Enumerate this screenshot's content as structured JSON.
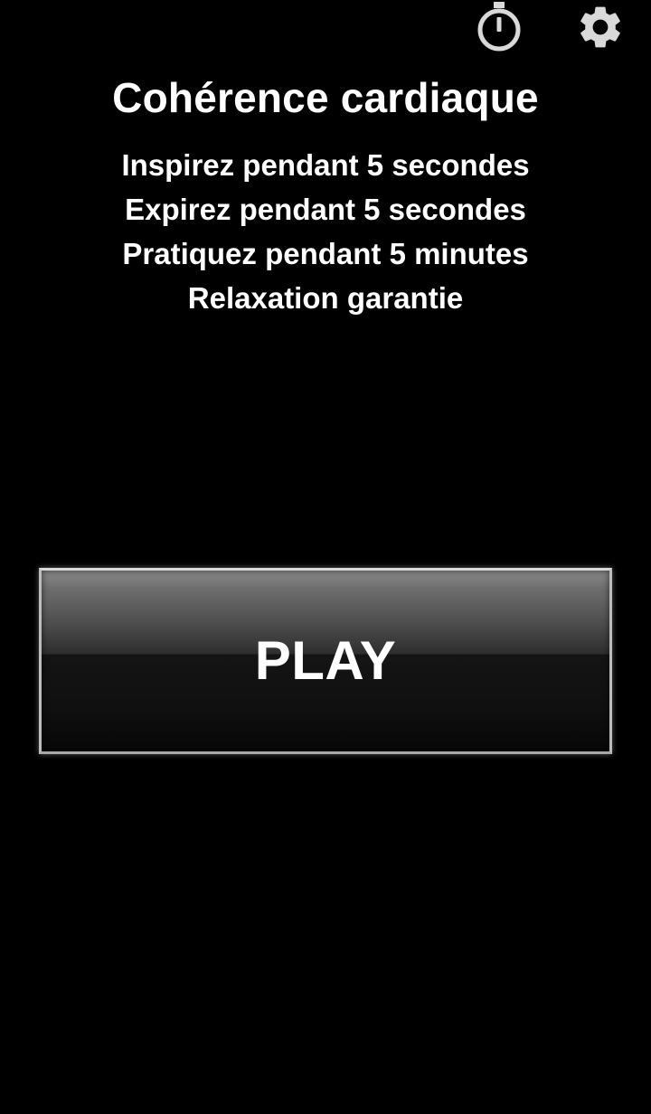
{
  "app": {
    "title": "Cohérence cardiaque"
  },
  "toolbar": {
    "timer_icon": "stopwatch-icon",
    "settings_icon": "gear-icon"
  },
  "instructions": [
    "Inspirez pendant 5 secondes",
    "Expirez pendant 5 secondes",
    "Pratiquez pendant 5 minutes",
    "Relaxation garantie"
  ],
  "play_button": {
    "label": "PLAY"
  },
  "colors": {
    "background": "#000000",
    "text": "#ffffff",
    "icon": "#d9d9d9",
    "button_border": "#bdbdbd"
  }
}
